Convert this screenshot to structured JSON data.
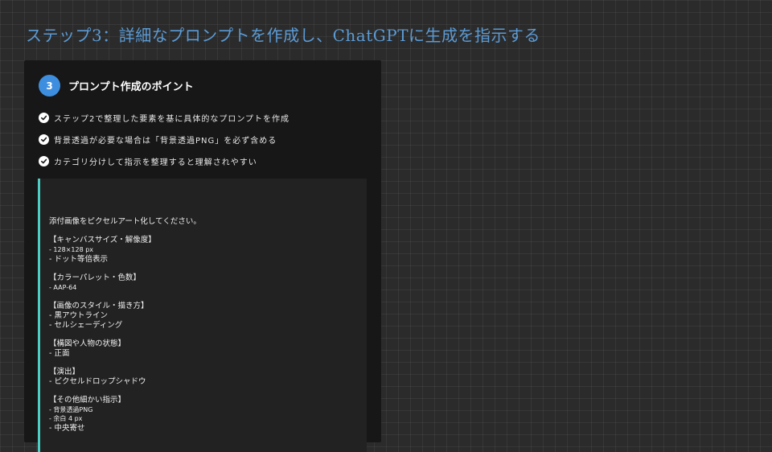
{
  "title": "ステップ3：詳細なプロンプトを作成し、ChatGPTに生成を指示する",
  "panel": {
    "step_number": "3",
    "heading": "プロンプト作成のポイント",
    "points": [
      "ステップ2で整理した要素を基に具体的なプロンプトを作成",
      "背景透過が必要な場合は「背景透過PNG」を必ず含める",
      "カテゴリ分けして指示を整理すると理解されやすい"
    ],
    "prompt_lines": [
      "添付画像をピクセルアート化してください。",
      "",
      "【キャンバスサイズ・解像度】",
      "- 128×128 px",
      "- ドット等倍表示",
      "",
      "【カラーパレット・色数】",
      "- AAP-64",
      "",
      "【画像のスタイル・描き方】",
      "- 黒アウトライン",
      "- セルシェーディング",
      "",
      "【構図や人物の状態】",
      "- 正面",
      "",
      "【演出】",
      "- ピクセルドロップシャドウ",
      "",
      "【その他細かい指示】",
      "- 背景透過PNG",
      "- 余白 4 px",
      "- 中央寄せ"
    ]
  },
  "icons": {
    "check": "check-circle-icon"
  },
  "colors": {
    "title": "#5b9bd5",
    "badge": "#3e8ee0",
    "prompt_accent": "#4ecdc4",
    "panel_bg": "#171717"
  }
}
